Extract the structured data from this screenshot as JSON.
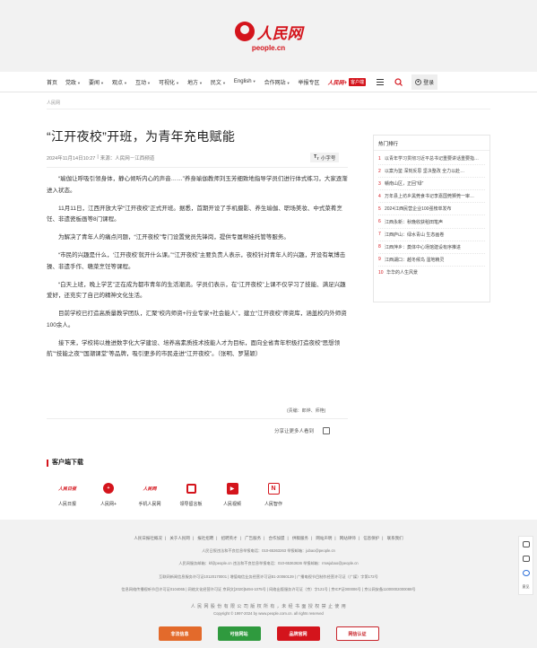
{
  "header": {
    "logo_cn": "人民网",
    "logo_domain": "people.cn"
  },
  "nav": {
    "items": [
      "首页",
      "党政",
      "要闻",
      "观点",
      "互动",
      "可视化",
      "地方",
      "民文",
      "English",
      "合作网站",
      "举报专区"
    ],
    "client_brand": "人民网+",
    "client_tag": "客户端",
    "login": "登录"
  },
  "breadcrumb": "人民网",
  "article": {
    "title": "“江开夜校”开班，为青年充电赋能",
    "datetime": "2024年11月14日10:27",
    "separator": "|",
    "source": "来源：人民网－江西频道",
    "font_toggle": "小字号",
    "paragraphs": [
      "“瑜伽让呼吸引领身体，静心倾听内心的声音……”养身瑜伽教师刘玉芳细致地指导学员们进行体式练习，大家逐渐进入状态。",
      "11月11日，江西开放大学“江开夜校”正式开班。据悉，首期开设了手机摄影、养生瑜伽、职场美妆、中式菜肴烹饪、非遗瓷板画等8门课程。",
      "为解决了青年人的痛点问题，“江开夜校”专门设置党员先锋岗，提供专属帮娃托管等服务。",
      "“市民的兴趣是什么，‘江开夜校’就开什么课。”“江开夜校”主要负责人表示，夜校针对青年人的兴趣，开设有氧博击操、非遗手作、赣菜烹饪等课程。",
      "“白天上班，晚上学艺”正在成为都市青年的生活潮流。学员们表示，在“江开夜校”上课不仅学习了技能、满足兴趣爱好，还充实了自己的精神文化生活。",
      "目前学校已打造高质量教学团队，汇聚“校内师资+行业专家+社会能人”，建立“江开夜校”师资库，涵盖校内外师资100余人。",
      "接下来，学校将以推进数字化大学建设、培养高素质技术技能人才为目标，面向全省青年积极打造夜校“思想领航”“技能之夜”“国潮课堂”等品牌，吸引更多的市民走进“江开夜校”。（张明、罗慧颖）"
    ],
    "editor": "(责编：郎烨、师艳)",
    "share": "分享让更多人看到"
  },
  "download": {
    "title": "客户端下载",
    "apps": [
      {
        "name": "人民日报",
        "icon": "people-daily-icon",
        "glyph": "人民日报"
      },
      {
        "name": "人民网+",
        "icon": "people-plus-icon",
        "glyph": "+"
      },
      {
        "name": "手机人民网",
        "icon": "mobile-people-icon",
        "glyph": "人民网"
      },
      {
        "name": "领导留言板",
        "icon": "message-board-icon",
        "glyph": "▢"
      },
      {
        "name": "人民视频",
        "icon": "people-video-icon",
        "glyph": "▶"
      },
      {
        "name": "人民智作",
        "icon": "people-create-icon",
        "glyph": "N"
      }
    ]
  },
  "sidebar": {
    "title": "热门排行",
    "items": [
      "以青年学习贯彻习近平总书记重要讲话重要指…",
      "以案为鉴 深刻反思 坚决整改 全力以赴…",
      "赣南山区，正回“绿”",
      "万年县上坊乡黑莞食书记李嘉国莞狮莞一审…",
      "2024江西民营企业100强榜单发布",
      "江西永新：秋晚收获稻田笔声",
      "江西庐山：绿水青山 生态画卷",
      "江西萍乡：奠体中心场馆建设有序推进",
      "江西湖口：越冬候鸟 湿地精灵",
      "华华的人生风景"
    ]
  },
  "footer": {
    "links": [
      "人民日报社概况",
      "关于人民网",
      "报社招聘",
      "招聘英才",
      "广告服务",
      "合作加盟",
      "供稿服务",
      "网站声明",
      "网站律师",
      "信息保护",
      "联系我们"
    ],
    "rows": [
      "人民日报违法和不良信息举报电话：010-65363263    举报邮箱：jubao@people.cn",
      "人民网服务邮箱：kf@people.cn    违法和不良信息举报电话：010-65363636    举报邮箱：rmwjubao@people.cn",
      "互联网新闻信息服务许可证10120170001 | 增值电信业务经营许可证B1-20060139 | 广播电视节目制作经营许可证（广媒）字第172号",
      "信息网络传播视听节目许可证0104065 | 网络文化经营许可证 京网文[2020]5494-1075号 | 网络出版服务许可证（京）字121号 | 京ICP证000006号 | 京公网安备11000002000088号",
      "人 民 网 股 份 有 限 公 司 版 权 所 有 ，未 经 书 面 授 权 禁 止 使 用",
      "Copyright © 1997-2024 by www.people.com.cn. all rights reserved"
    ],
    "badges": [
      {
        "label": "非法信息",
        "color": "#e36a2b"
      },
      {
        "label": "可信网站",
        "color": "#2f9a3e"
      },
      {
        "label": "品牌官网",
        "color": "#d4141c"
      },
      {
        "label": "网信认证",
        "color": "#c8242a"
      }
    ],
    "float": {
      "feedback": "意见"
    }
  }
}
